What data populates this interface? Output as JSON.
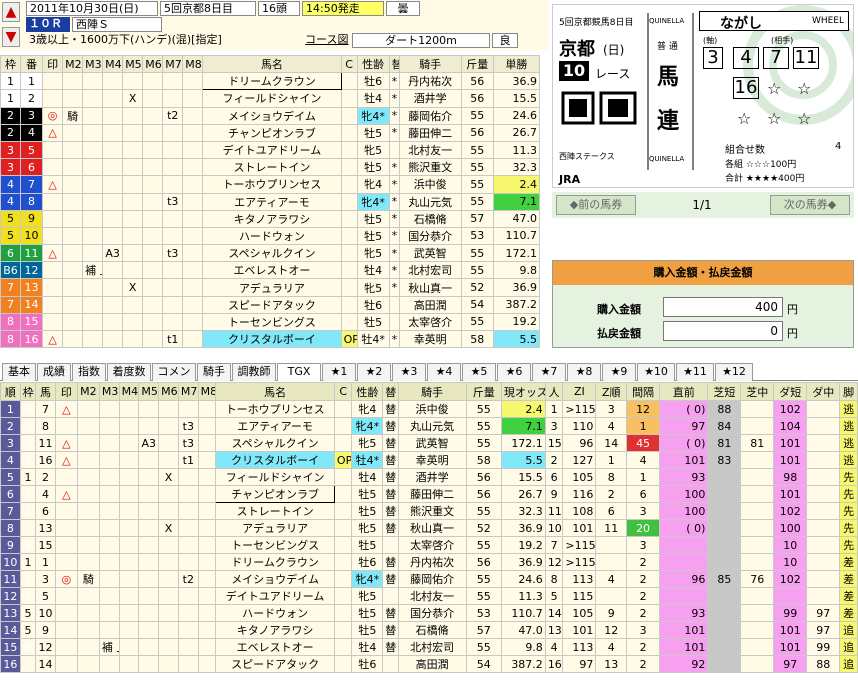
{
  "header": {
    "date": "2011年10月30日(日)",
    "kaisai": "5回京都8日目",
    "heads": "16頭",
    "start": "14:50発走",
    "weather": "曇",
    "race_no": "１０Ｒ",
    "race_name": "西陣Ｓ",
    "condition": "3歳以上・1600万下(ハンデ)(混)[指定]",
    "course_label": "コース図",
    "course": "ダート1200m",
    "going": "良",
    "up": "▲",
    "down": "▼"
  },
  "top_headers": [
    "枠",
    "番",
    "印",
    "M2",
    "M3",
    "M4",
    "M5",
    "M6",
    "M7",
    "M8",
    "馬名",
    "C",
    "性齢",
    "替",
    "騎手",
    "斤量",
    "単勝"
  ],
  "top_rows": [
    {
      "w": "1",
      "n": "1",
      "mk": "",
      "m4": "",
      "m5": "",
      "m7": "",
      "name": "ドリームクラウン",
      "c": "",
      "sa": "牡6",
      "ch": "*",
      "j": "丹内祐次",
      "kg": "56",
      "od": "36.9",
      "sel": true
    },
    {
      "w": "1",
      "n": "2",
      "mk": "",
      "m4": "",
      "m5": "X",
      "m7": "",
      "name": "フィールドシャイン",
      "c": "",
      "sa": "牡4",
      "ch": "*",
      "j": "酒井学",
      "kg": "56",
      "od": "15.5"
    },
    {
      "w": "2",
      "n": "3",
      "mk": "◎",
      "m2": "騎",
      "m4": "",
      "m5": "",
      "m7": "t2",
      "name": "メイショウデイム",
      "c": "",
      "sa": "牝4*",
      "ch": "*",
      "j": "藤岡佑介",
      "kg": "55",
      "od": "24.6",
      "cy": true
    },
    {
      "w": "2",
      "n": "4",
      "mk": "△",
      "m4": "",
      "m5": "",
      "m7": "",
      "name": "チャンピオンラブ",
      "c": "",
      "sa": "牡5",
      "ch": "*",
      "j": "藤田伸二",
      "kg": "56",
      "od": "26.7"
    },
    {
      "w": "3",
      "n": "5",
      "mk": "",
      "m4": "",
      "m5": "",
      "m7": "",
      "name": "デイトユアドリーム",
      "c": "",
      "sa": "牝5",
      "ch": "",
      "j": "北村友一",
      "kg": "55",
      "od": "11.3"
    },
    {
      "w": "3",
      "n": "6",
      "mk": "",
      "m4": "",
      "m5": "",
      "m7": "",
      "name": "ストレートイン",
      "c": "",
      "sa": "牡5",
      "ch": "*",
      "j": "熊沢重文",
      "kg": "55",
      "od": "32.3"
    },
    {
      "w": "4",
      "n": "7",
      "mk": "△",
      "m4": "",
      "m5": "",
      "m7": "",
      "name": "トーホウプリンセス",
      "c": "",
      "sa": "牝4",
      "ch": "*",
      "j": "浜中俊",
      "kg": "55",
      "od": "2.4",
      "oy": true
    },
    {
      "w": "4",
      "n": "8",
      "mk": "",
      "m4": "",
      "m5": "",
      "m7": "t3",
      "name": "エアティアーモ",
      "c": "",
      "sa": "牝4*",
      "ch": "*",
      "j": "丸山元気",
      "kg": "55",
      "od": "7.1",
      "cy": true,
      "og": true
    },
    {
      "w": "5",
      "n": "9",
      "mk": "",
      "m4": "",
      "m5": "",
      "m7": "",
      "name": "キタノアラワシ",
      "c": "",
      "sa": "牡5",
      "ch": "*",
      "j": "石橋脩",
      "kg": "57",
      "od": "47.0"
    },
    {
      "w": "5",
      "n": "10",
      "mk": "",
      "m4": "",
      "m5": "",
      "m7": "",
      "name": "ハードウォン",
      "c": "",
      "sa": "牡5",
      "ch": "*",
      "j": "国分恭介",
      "kg": "53",
      "od": "110.7"
    },
    {
      "w": "6",
      "n": "11",
      "mk": "△",
      "m4": "A3",
      "m5": "",
      "m7": "t3",
      "name": "スペシャルクイン",
      "c": "",
      "sa": "牝5",
      "ch": "*",
      "j": "武英智",
      "kg": "55",
      "od": "172.1"
    },
    {
      "w": "B6",
      "n": "12",
      "mk": "",
      "m3": "補 上",
      "m4": "",
      "m5": "",
      "m7": "",
      "name": "エベレストオー",
      "c": "",
      "sa": "牡4",
      "ch": "*",
      "j": "北村宏司",
      "kg": "55",
      "od": "9.8"
    },
    {
      "w": "7",
      "n": "13",
      "mk": "",
      "m4": "",
      "m5": "X",
      "m7": "",
      "name": "アデュラリア",
      "c": "",
      "sa": "牝5",
      "ch": "*",
      "j": "秋山真一",
      "kg": "52",
      "od": "36.9"
    },
    {
      "w": "7",
      "n": "14",
      "mk": "",
      "m4": "",
      "m5": "",
      "m7": "",
      "name": "スピードアタック",
      "c": "",
      "sa": "牡6",
      "ch": "",
      "j": "高田潤",
      "kg": "54",
      "od": "387.2"
    },
    {
      "w": "8",
      "n": "15",
      "mk": "",
      "m4": "",
      "m5": "",
      "m7": "",
      "name": "トーセンビングス",
      "c": "",
      "sa": "牡5",
      "ch": "",
      "j": "太宰啓介",
      "kg": "55",
      "od": "19.2"
    },
    {
      "w": "8",
      "n": "16",
      "mk": "△",
      "m4": "",
      "m5": "",
      "m7": "t1",
      "name": "クリスタルボーイ",
      "c": "OP",
      "sa": "牡4*",
      "ch": "*",
      "j": "幸英明",
      "kg": "58",
      "od": "5.5",
      "cyn": true,
      "oc": true
    }
  ],
  "ticket": {
    "top": "5回京都競馬8日目",
    "quinella": "QUINELLA",
    "venue": "京都",
    "day": "(日)",
    "race": "10",
    "race_unit": "レース",
    "type": "馬",
    "type2": "連",
    "futsu": "普 通",
    "nagashi": "ながし",
    "wheel": "WHEEL",
    "jiku_label": "(軸)",
    "aite_label": "(相手)",
    "jiku": "3",
    "aite": [
      "4",
      "7",
      "11",
      "16"
    ],
    "stars": [
      "☆",
      "☆",
      "☆",
      "☆",
      "☆",
      "☆"
    ],
    "race_name": "西陣ステークス",
    "jra": "JRA",
    "kumiawase": "組合せ数",
    "kumi_count": "4",
    "kakume": "各組 ☆☆☆100円",
    "goukei": "合計 ★★★★400円"
  },
  "nav": {
    "prev": "◆前の馬券",
    "page": "1/1",
    "next": "次の馬券◆"
  },
  "kounyu": {
    "title": "購入金額・払戻金額",
    "buy_label": "購入金額",
    "buy": "400",
    "pay_label": "払戻金額",
    "pay": "0",
    "yen": "円"
  },
  "tabs": [
    "基本",
    "成績",
    "指数",
    "着度数",
    "コメント",
    "騎手",
    "調教師",
    "TGX",
    "★1",
    "★2",
    "★3",
    "★4",
    "★5",
    "★6",
    "★7",
    "★8",
    "★9",
    "★10",
    "★11",
    "★12"
  ],
  "bot_headers": [
    "順",
    "枠",
    "馬",
    "印",
    "M2",
    "M3",
    "M4",
    "M5",
    "M6",
    "M7",
    "M8",
    "馬名",
    "C",
    "性齢",
    "替",
    "騎手",
    "斤量",
    "現オッズ",
    "人",
    "ZI",
    "Z順",
    "間隔",
    "直前",
    "芝短",
    "芝中",
    "ダ短",
    "ダ中",
    "脚"
  ],
  "bot_rows": [
    {
      "o": "1",
      "w": "4",
      "n": "7",
      "mk": "△",
      "m7": "",
      "name": "トーホウプリンセス",
      "c": "",
      "sa": "牝4",
      "ch": "替",
      "j": "浜中俊",
      "kg": "55",
      "od": "2.4",
      "p": "1",
      "zi": ">115",
      "zr": "3",
      "iv": "12",
      "ch2": "(  0)",
      "st": "88",
      "sm": "",
      "ds": "102",
      "dm": "",
      "kk": "逃"
    },
    {
      "o": "2",
      "w": "4",
      "n": "8",
      "mk": "",
      "m7": "t3",
      "name": "エアティアーモ",
      "c": "",
      "sa": "牝4*",
      "ch": "替",
      "j": "丸山元気",
      "kg": "55",
      "od": "7.1",
      "p": "3",
      "zi": "110",
      "zr": "4",
      "iv": "1",
      "ch2": "97",
      "st": "84",
      "sm": "",
      "ds": "104",
      "dm": "",
      "kk": "逃"
    },
    {
      "o": "3",
      "w": "6",
      "n": "11",
      "mk": "△",
      "m5": "A3",
      "m7": "t3",
      "name": "スペシャルクイン",
      "c": "",
      "sa": "牝5",
      "ch": "替",
      "j": "武英智",
      "kg": "55",
      "od": "172.1",
      "p": "15",
      "zi": "96",
      "zr": "14",
      "iv": "45",
      "ch2": "(  0)",
      "st": "81",
      "sm": "81",
      "ds": "101",
      "dm": "",
      "kk": "逃"
    },
    {
      "o": "4",
      "w": "8",
      "n": "16",
      "mk": "△",
      "m7": "t1",
      "name": "クリスタルボーイ",
      "c": "OP",
      "sa": "牡4*",
      "ch": "替",
      "j": "幸英明",
      "kg": "58",
      "od": "5.5",
      "p": "2",
      "zi": "127",
      "zr": "1",
      "iv": "4",
      "ch2": "101",
      "st": "83",
      "sm": "",
      "ds": "101",
      "dm": "",
      "kk": "逃"
    },
    {
      "o": "5",
      "w": "1",
      "n": "2",
      "mk": "",
      "m6": "X",
      "m7": "",
      "name": "フィールドシャイン",
      "c": "",
      "sa": "牡4",
      "ch": "替",
      "j": "酒井学",
      "kg": "56",
      "od": "15.5",
      "p": "6",
      "zi": "105",
      "zr": "8",
      "iv": "1",
      "ch2": "93",
      "st": "",
      "sm": "",
      "ds": "98",
      "dm": "",
      "kk": "先"
    },
    {
      "o": "6",
      "w": "2",
      "n": "4",
      "mk": "△",
      "m7": "",
      "name": "チャンピオンラブ",
      "c": "",
      "sa": "牡5",
      "ch": "替",
      "j": "藤田伸二",
      "kg": "56",
      "od": "26.7",
      "p": "9",
      "zi": "116",
      "zr": "2",
      "iv": "6",
      "ch2": "100",
      "st": "",
      "sm": "",
      "ds": "101",
      "dm": "",
      "kk": "先"
    },
    {
      "o": "7",
      "w": "3",
      "n": "6",
      "mk": "",
      "m7": "",
      "name": "ストレートイン",
      "c": "",
      "sa": "牡5",
      "ch": "替",
      "j": "熊沢重文",
      "kg": "55",
      "od": "32.3",
      "p": "11",
      "zi": "108",
      "zr": "6",
      "iv": "3",
      "ch2": "100",
      "st": "",
      "sm": "",
      "ds": "102",
      "dm": "",
      "kk": "先"
    },
    {
      "o": "8",
      "w": "7",
      "n": "13",
      "mk": "",
      "m6": "X",
      "m7": "",
      "name": "アデュラリア",
      "c": "",
      "sa": "牝5",
      "ch": "替",
      "j": "秋山真一",
      "kg": "52",
      "od": "36.9",
      "p": "10",
      "zi": "101",
      "zr": "11",
      "iv": "20",
      "ch2": "(  0)",
      "st": "",
      "sm": "",
      "ds": "100",
      "dm": "",
      "kk": "先"
    },
    {
      "o": "9",
      "w": "8",
      "n": "15",
      "mk": "",
      "m7": "",
      "name": "トーセンビングス",
      "c": "",
      "sa": "牡5",
      "ch": "",
      "j": "太宰啓介",
      "kg": "55",
      "od": "19.2",
      "p": "7",
      "zi": ">115",
      "zr": "",
      "iv": "3",
      "ch2": "",
      "st": "",
      "sm": "",
      "ds": "10",
      "dm": "",
      "kk": "先"
    },
    {
      "o": "10",
      "w": "1",
      "n": "1",
      "mk": "",
      "m7": "",
      "name": "ドリームクラウン",
      "c": "",
      "sa": "牡6",
      "ch": "替",
      "j": "丹内祐次",
      "kg": "56",
      "od": "36.9",
      "p": "12",
      "zi": ">115",
      "zr": "",
      "iv": "2",
      "ch2": "",
      "st": "",
      "sm": "",
      "ds": "10",
      "dm": "",
      "kk": "差"
    },
    {
      "o": "11",
      "w": "2",
      "n": "3",
      "mk": "◎",
      "m2": "騎",
      "m7": "t2",
      "name": "メイショウデイム",
      "c": "",
      "sa": "牝4*",
      "ch": "替",
      "j": "藤岡佑介",
      "kg": "55",
      "od": "24.6",
      "p": "8",
      "zi": "113",
      "zr": "4",
      "iv": "2",
      "ch2": "96",
      "st": "85",
      "sm": "76",
      "ds": "102",
      "dm": "",
      "kk": "差"
    },
    {
      "o": "12",
      "w": "3",
      "n": "5",
      "mk": "",
      "m7": "",
      "name": "デイトユアドリーム",
      "c": "",
      "sa": "牝5",
      "ch": "",
      "j": "北村友一",
      "kg": "55",
      "od": "11.3",
      "p": "5",
      "zi": "115",
      "zr": "",
      "iv": "2",
      "ch2": "",
      "st": "",
      "sm": "",
      "ds": "",
      "dm": "",
      "kk": "差"
    },
    {
      "o": "13",
      "w": "5",
      "n": "10",
      "mk": "",
      "m7": "",
      "name": "ハードウォン",
      "c": "",
      "sa": "牡5",
      "ch": "替",
      "j": "国分恭介",
      "kg": "53",
      "od": "110.7",
      "p": "14",
      "zi": "105",
      "zr": "9",
      "iv": "2",
      "ch2": "93",
      "st": "",
      "sm": "",
      "ds": "99",
      "dm": "97",
      "kk": "差"
    },
    {
      "o": "14",
      "w": "5",
      "n": "9",
      "mk": "",
      "m7": "",
      "name": "キタノアラワシ",
      "c": "",
      "sa": "牡5",
      "ch": "替",
      "j": "石橋脩",
      "kg": "57",
      "od": "47.0",
      "p": "13",
      "zi": "101",
      "zr": "12",
      "iv": "3",
      "ch2": "101",
      "st": "",
      "sm": "",
      "ds": "101",
      "dm": "97",
      "kk": "追"
    },
    {
      "o": "15",
      "w": "B6",
      "n": "12",
      "mk": "",
      "m3": "補 上",
      "m7": "",
      "name": "エベレストオー",
      "c": "",
      "sa": "牡4",
      "ch": "替",
      "j": "北村宏司",
      "kg": "55",
      "od": "9.8",
      "p": "4",
      "zi": "113",
      "zr": "4",
      "iv": "2",
      "ch2": "101",
      "st": "",
      "sm": "",
      "ds": "101",
      "dm": "99",
      "kk": "追"
    },
    {
      "o": "16",
      "w": "7",
      "n": "14",
      "mk": "",
      "m7": "",
      "name": "スピードアタック",
      "c": "",
      "sa": "牡6",
      "ch": "",
      "j": "高田潤",
      "kg": "54",
      "od": "387.2",
      "p": "16",
      "zi": "97",
      "zr": "13",
      "iv": "2",
      "ch2": "92",
      "st": "",
      "sm": "",
      "ds": "97",
      "dm": "88",
      "kk": "追"
    }
  ]
}
